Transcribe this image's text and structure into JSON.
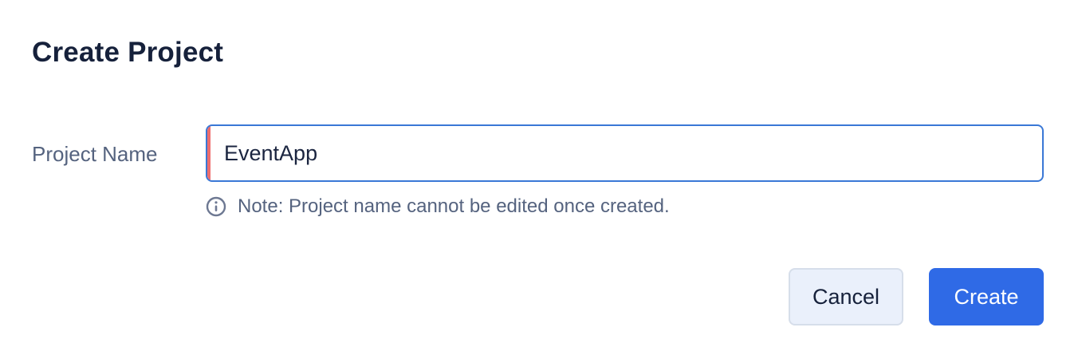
{
  "dialog": {
    "title": "Create Project",
    "field": {
      "label": "Project Name",
      "value": "EventApp",
      "required": true
    },
    "note": {
      "icon": "info-icon",
      "text": "Note: Project name cannot be edited once created."
    },
    "actions": {
      "cancel_label": "Cancel",
      "create_label": "Create"
    }
  },
  "colors": {
    "title": "#16213b",
    "label": "#55637f",
    "input_border": "#3a78d6",
    "required_indicator": "#ee6d6d",
    "primary": "#2f6ae6",
    "secondary_bg": "#eaf0fb"
  }
}
